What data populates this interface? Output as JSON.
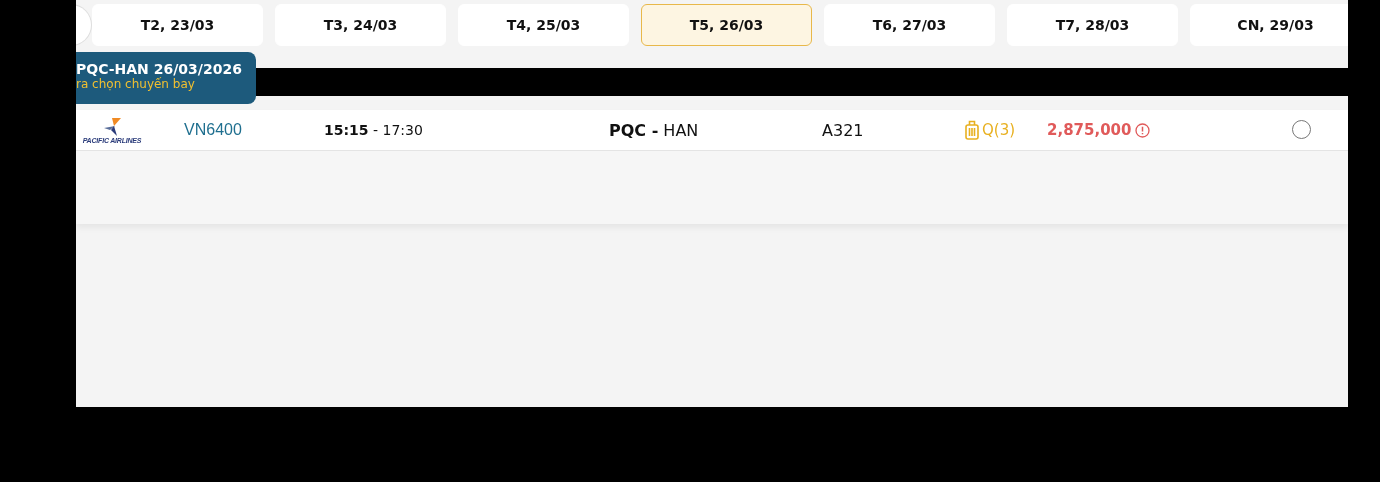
{
  "date_tabs": [
    {
      "label": "T2, 23/03",
      "selected": false
    },
    {
      "label": "T3, 24/03",
      "selected": false
    },
    {
      "label": "T4, 25/03",
      "selected": false
    },
    {
      "label": "T5, 26/03",
      "selected": true
    },
    {
      "label": "T6, 27/03",
      "selected": false
    },
    {
      "label": "T7, 28/03",
      "selected": false
    },
    {
      "label": "CN, 29/03",
      "selected": false
    }
  ],
  "banner": {
    "title": "PQC-HAN 26/03/2026",
    "subtitle": "ra chọn chuyến bay"
  },
  "flights": [
    {
      "airline": "PACIFIC AIRLINES",
      "flight_number": "VN6400",
      "depart": "15:15",
      "separator": "-",
      "arrive": "17:30",
      "origin": "PQC",
      "destination": "HAN",
      "aircraft": "A321",
      "fare_class": "Q(3)",
      "price": "2,875,000",
      "selected": false
    }
  ]
}
